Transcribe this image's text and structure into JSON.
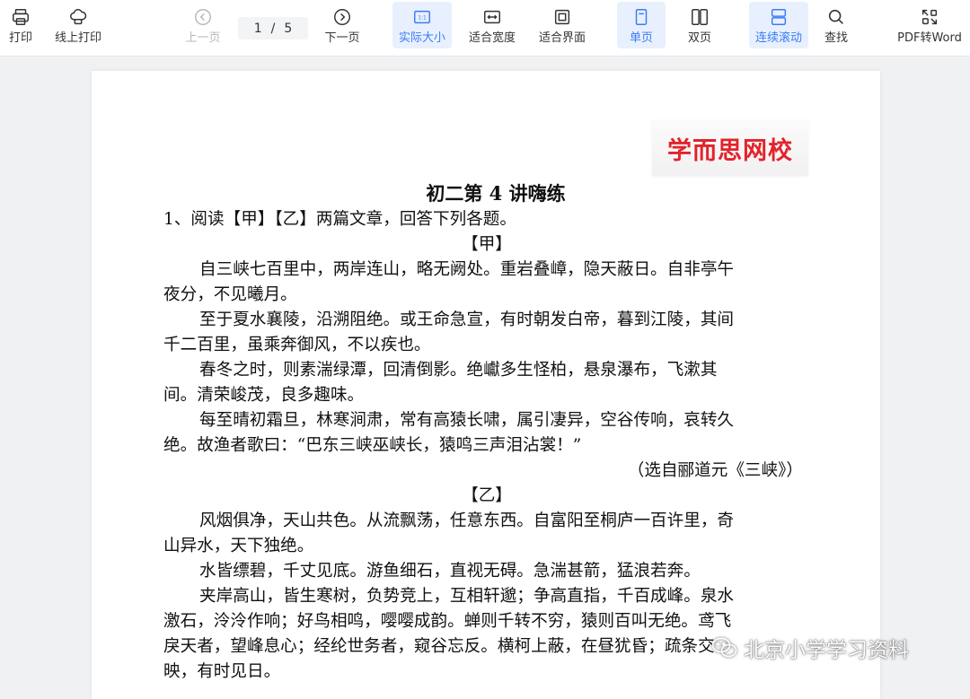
{
  "toolbar": {
    "print": "打印",
    "online_print": "线上打印",
    "prev_page": "上一页",
    "current_page": "1",
    "page_separator": "/",
    "total_pages": "5",
    "next_page": "下一页",
    "actual_size": "实际大小",
    "fit_width": "适合宽度",
    "fit_page": "适合界面",
    "single_page": "单页",
    "double_page": "双页",
    "continuous_scroll": "连续滚动",
    "find": "查找",
    "pdf_to_word": "PDF转Word"
  },
  "colors": {
    "accent": "#3b7cf4",
    "logo_red": "#e3232b"
  },
  "document": {
    "logo": "学而思网校",
    "title": "初二第 4 讲嗨练",
    "lines": [
      "1、阅读【甲】【乙】两篇文章，回答下列各题。",
      "【甲】",
      "自三峡七百里中，两岸连山，略无阙处。重岩叠嶂，隐天蔽日。自非亭午",
      "夜分，不见曦月。",
      "至于夏水襄陵，沿溯阻绝。或王命急宣，有时朝发白帝，暮到江陵，其间",
      "千二百里，虽乘奔御风，不以疾也。",
      "春冬之时，则素湍绿潭，回清倒影。绝巘多生怪柏，悬泉瀑布，飞漱其",
      "间。清荣峻茂，良多趣味。",
      "每至晴初霜旦，林寒涧肃，常有高猿长啸，属引凄异，空谷传响，哀转久",
      "绝。故渔者歌曰：“巴东三峡巫峡长，猿鸣三声泪沾裳！”",
      "（选自郦道元《三峡》）",
      "【乙】",
      "风烟俱净，天山共色。从流飘荡，任意东西。自富阳至桐庐一百许里，奇",
      "山异水，天下独绝。",
      "水皆缥碧，千丈见底。游鱼细石，直视无碍。急湍甚箭，猛浪若奔。",
      "夹岸高山，皆生寒树，负势竞上，互相轩邈；争高直指，千百成峰。泉水",
      "激石，泠泠作响；好鸟相鸣，嘤嘤成韵。蝉则千转不穷，猿则百叫无绝。鸢飞",
      "戾天者，望峰息心；经纶世务者，窥谷忘反。横柯上蔽，在昼犹昏；疏条交",
      "映，有时见日。"
    ]
  },
  "watermark": "北京小学学习资料"
}
